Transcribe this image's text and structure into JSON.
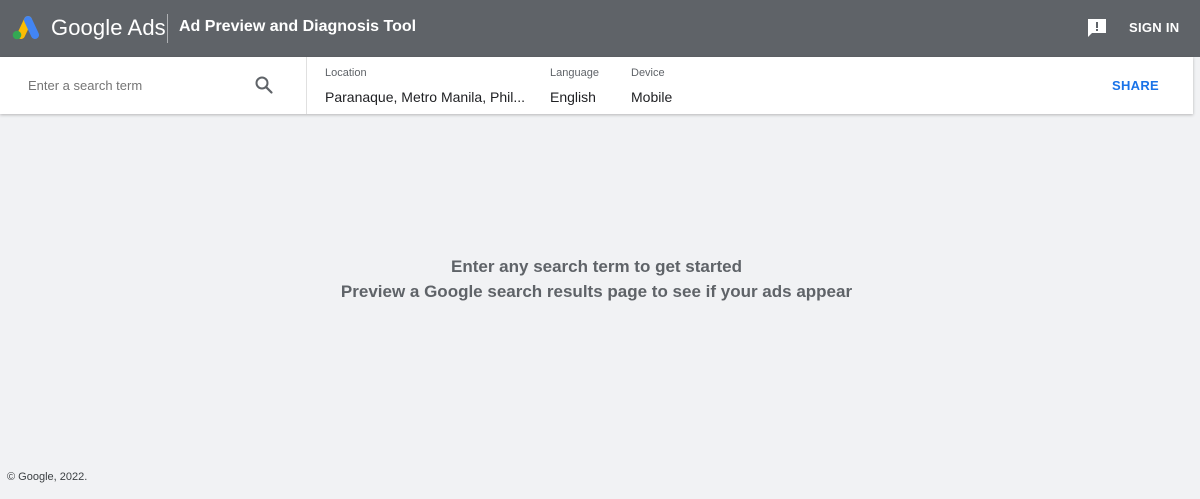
{
  "header": {
    "brand": "Google Ads",
    "tool_title": "Ad Preview and Diagnosis Tool",
    "feedback_icon": "feedback-icon",
    "signin_label": "SIGN IN"
  },
  "toolbar": {
    "search": {
      "placeholder": "Enter a search term",
      "value": "",
      "icon": "search-icon"
    },
    "location": {
      "label": "Location",
      "value": "Paranaque, Metro Manila, Phil..."
    },
    "language": {
      "label": "Language",
      "value": "English"
    },
    "device": {
      "label": "Device",
      "value": "Mobile"
    },
    "share_label": "SHARE"
  },
  "main": {
    "line1": "Enter any search term to get started",
    "line2": "Preview a Google search results page to see if your ads appear"
  },
  "footer": {
    "copyright": "© Google, 2022."
  },
  "colors": {
    "header_bg": "#5f6368",
    "page_bg": "#f1f2f4",
    "accent": "#1a73e8",
    "logo_blue": "#4285f4",
    "logo_yellow": "#fbbc04",
    "logo_green": "#34a853"
  }
}
